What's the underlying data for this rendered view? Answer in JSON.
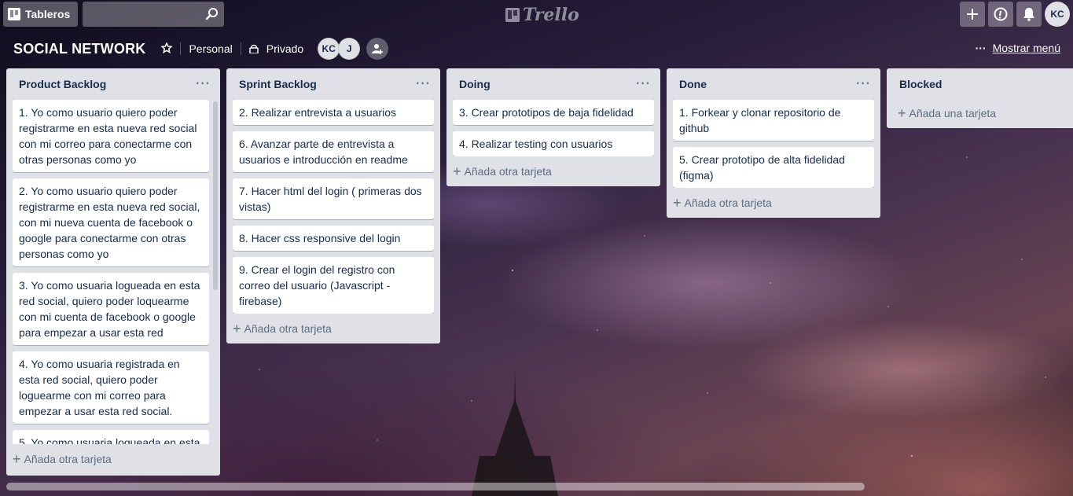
{
  "header": {
    "boards_label": "Tableros",
    "search_placeholder": "",
    "logo_text": "Trello",
    "user_initials": "KC"
  },
  "board": {
    "title": "SOCIAL NETWORK",
    "team": "Personal",
    "visibility": "Privado",
    "members": [
      "KC",
      "J"
    ],
    "show_menu": "Mostrar menú"
  },
  "lists": [
    {
      "title": "Product Backlog",
      "cards": [
        "1. Yo como usuario quiero poder registrarme en esta nueva red social con mi correo para conectarme con otras personas como yo",
        "2. Yo como usuario quiero poder registrarme en esta nueva red social, con mi nueva cuenta de facebook o google para conectarme con otras personas como yo",
        "3. Yo como usuaria logueada en esta red social, quiero poder loquearme con mi cuenta de facebook o google para empezar a usar esta red",
        "4. Yo como usuaria registrada en esta red social, quiero poder loguearme con mi correo para empezar a usar esta red social.",
        "5. Yo como usuaria logueada en esta"
      ],
      "add_label": "Añada otra tarjeta"
    },
    {
      "title": "Sprint Backlog",
      "cards": [
        "2. Realizar entrevista a usuarios",
        "6. Avanzar parte de entrevista a usuarios e introducción en readme",
        "7. Hacer html del login ( primeras dos vistas)",
        "8. Hacer css responsive del login",
        "9. Crear el login del registro con correo del usuario (Javascript - firebase)"
      ],
      "add_label": "Añada otra tarjeta"
    },
    {
      "title": "Doing",
      "cards": [
        "3. Crear prototipos de baja fidelidad",
        "4. Realizar testing con usuarios"
      ],
      "add_label": "Añada otra tarjeta"
    },
    {
      "title": "Done",
      "cards": [
        "1. Forkear y clonar repositorio de github",
        "5. Crear prototipo de alta fidelidad (figma)"
      ],
      "add_label": "Añada otra tarjeta"
    },
    {
      "title": "Blocked",
      "cards": [],
      "add_label": "Añada una tarjeta"
    }
  ]
}
